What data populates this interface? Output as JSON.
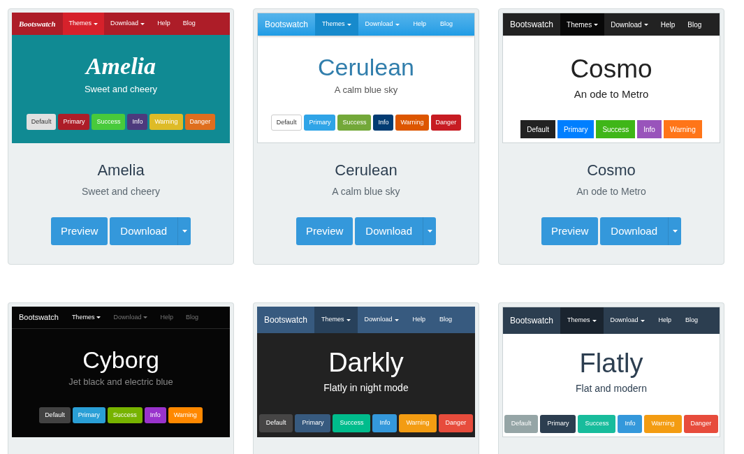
{
  "cards": [
    {
      "preview": {
        "kind": "amelia",
        "navbar": {
          "brand": "Bootswatch",
          "items": [
            {
              "label": "Themes",
              "dropdown": true,
              "selected": true
            },
            {
              "label": "Download",
              "dropdown": true,
              "selected": false
            },
            {
              "label": "Help",
              "dropdown": false,
              "selected": false
            },
            {
              "label": "Blog",
              "dropdown": false,
              "selected": false
            }
          ]
        },
        "heading": "Amelia",
        "tagline": "Sweet and cheery",
        "buttons": [
          {
            "label": "Default",
            "color": "#e0e0e0"
          },
          {
            "label": "Primary",
            "color": "#ad1d28"
          },
          {
            "label": "Success",
            "color": "#48ca3b"
          },
          {
            "label": "Info",
            "color": "#4d3a7d"
          },
          {
            "label": "Warning",
            "color": "#debb27"
          },
          {
            "label": "Danger",
            "color": "#df6e1e"
          }
        ]
      },
      "name": "Amelia",
      "description": "Sweet and cheery",
      "actions": [
        {
          "label": "Preview",
          "kind": "button"
        },
        {
          "label": "Download",
          "kind": "split"
        }
      ]
    },
    {
      "preview": {
        "kind": "cerulean",
        "navbar": {
          "brand": "Bootswatch",
          "items": [
            {
              "label": "Themes",
              "dropdown": true,
              "selected": true
            },
            {
              "label": "Download",
              "dropdown": true,
              "selected": false
            },
            {
              "label": "Help",
              "dropdown": false,
              "selected": false
            },
            {
              "label": "Blog",
              "dropdown": false,
              "selected": false
            }
          ]
        },
        "heading": "Cerulean",
        "tagline": "A calm blue sky",
        "buttons": [
          {
            "label": "Default",
            "color": "#ffffff"
          },
          {
            "label": "Primary",
            "color": "#2fa4e7"
          },
          {
            "label": "Success",
            "color": "#73a839"
          },
          {
            "label": "Info",
            "color": "#033c73"
          },
          {
            "label": "Warning",
            "color": "#dd5600"
          },
          {
            "label": "Danger",
            "color": "#c71c22"
          }
        ]
      },
      "name": "Cerulean",
      "description": "A calm blue sky",
      "actions": [
        {
          "label": "Preview",
          "kind": "button"
        },
        {
          "label": "Download",
          "kind": "split"
        }
      ]
    },
    {
      "preview": {
        "kind": "cosmo",
        "navbar": {
          "brand": "Bootswatch",
          "items": [
            {
              "label": "Themes",
              "dropdown": true,
              "selected": true
            },
            {
              "label": "Download",
              "dropdown": true,
              "selected": false
            },
            {
              "label": "Help",
              "dropdown": false,
              "selected": false
            },
            {
              "label": "Blog",
              "dropdown": false,
              "selected": false
            }
          ]
        },
        "heading": "Cosmo",
        "tagline": "An ode to Metro",
        "buttons": [
          {
            "label": "Default",
            "color": "#222222"
          },
          {
            "label": "Primary",
            "color": "#007fff"
          },
          {
            "label": "Success",
            "color": "#3fb618"
          },
          {
            "label": "Info",
            "color": "#9954bb"
          },
          {
            "label": "Warning",
            "color": "#ff7518"
          }
        ]
      },
      "name": "Cosmo",
      "description": "An ode to Metro",
      "actions": [
        {
          "label": "Preview",
          "kind": "button"
        },
        {
          "label": "Download",
          "kind": "split"
        }
      ]
    },
    {
      "preview": {
        "kind": "cyborg",
        "navbar": {
          "brand": "Bootswatch",
          "items": [
            {
              "label": "Themes",
              "dropdown": true,
              "selected": true
            },
            {
              "label": "Download",
              "dropdown": true,
              "selected": false
            },
            {
              "label": "Help",
              "dropdown": false,
              "selected": false
            },
            {
              "label": "Blog",
              "dropdown": false,
              "selected": false
            }
          ]
        },
        "heading": "Cyborg",
        "tagline": "Jet black and electric blue",
        "buttons": [
          {
            "label": "Default",
            "color": "#424242"
          },
          {
            "label": "Primary",
            "color": "#2a9fd6"
          },
          {
            "label": "Success",
            "color": "#77b300"
          },
          {
            "label": "Info",
            "color": "#9933cc"
          },
          {
            "label": "Warning",
            "color": "#ff8800"
          }
        ]
      }
    },
    {
      "preview": {
        "kind": "darkly",
        "navbar": {
          "brand": "Bootswatch",
          "items": [
            {
              "label": "Themes",
              "dropdown": true,
              "selected": true
            },
            {
              "label": "Download",
              "dropdown": true,
              "selected": false
            },
            {
              "label": "Help",
              "dropdown": false,
              "selected": false
            },
            {
              "label": "Blog",
              "dropdown": false,
              "selected": false
            }
          ]
        },
        "heading": "Darkly",
        "tagline": "Flatly in night mode",
        "buttons": [
          {
            "label": "Default",
            "color": "#464545"
          },
          {
            "label": "Primary",
            "color": "#375a7f"
          },
          {
            "label": "Success",
            "color": "#00bc8c"
          },
          {
            "label": "Info",
            "color": "#3498db"
          },
          {
            "label": "Warning",
            "color": "#f39c12"
          },
          {
            "label": "Danger",
            "color": "#e74c3c"
          }
        ]
      }
    },
    {
      "preview": {
        "kind": "flatly",
        "navbar": {
          "brand": "Bootswatch",
          "items": [
            {
              "label": "Themes",
              "dropdown": true,
              "selected": true
            },
            {
              "label": "Download",
              "dropdown": true,
              "selected": false
            },
            {
              "label": "Help",
              "dropdown": false,
              "selected": false
            },
            {
              "label": "Blog",
              "dropdown": false,
              "selected": false
            }
          ]
        },
        "heading": "Flatly",
        "tagline": "Flat and modern",
        "buttons": [
          {
            "label": "Default",
            "color": "#95a5a6"
          },
          {
            "label": "Primary",
            "color": "#2c3e50"
          },
          {
            "label": "Success",
            "color": "#18bc9c"
          },
          {
            "label": "Info",
            "color": "#3498db"
          },
          {
            "label": "Warning",
            "color": "#f39c12"
          },
          {
            "label": "Danger",
            "color": "#e74c3c"
          }
        ]
      }
    }
  ]
}
